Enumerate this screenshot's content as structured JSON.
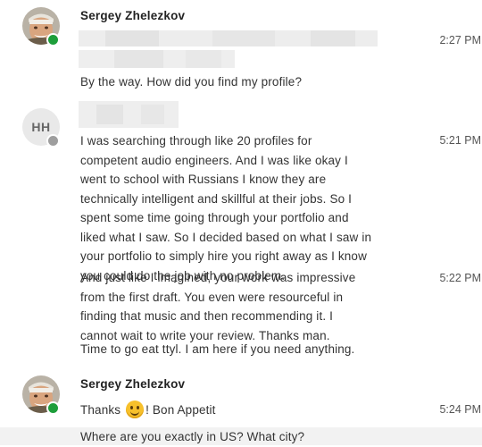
{
  "thread": {
    "messages": [
      {
        "sender": "Sergey Zhelezkov",
        "time": "2:27 PM",
        "text": "By the way. How did you find my profile?"
      },
      {
        "initials": "HH",
        "time": "5:21 PM",
        "text_lines": [
          "I was searching through like 20 profiles for",
          "competent audio engineers. And I was like okay I",
          "went to school with Russians I know they are",
          "technically intelligent and skillful at their jobs. So I",
          "spent some time going through your portfolio and",
          "liked what I saw. So I decided based on what I saw in",
          "your portfolio to simply hire you right away as I know",
          "you could do the job with no problem."
        ]
      },
      {
        "time": "5:22 PM",
        "text_lines": [
          "And just like I imagined, your work was impressive",
          "from the first draft. You even were resourceful in",
          "finding that music and then recommending it. I",
          "cannot wait to write your review. Thanks man."
        ]
      },
      {
        "text": "Time to go eat ttyl. I am here if you need anything."
      },
      {
        "sender": "Sergey Zhelezkov",
        "time": "5:24 PM",
        "text_before": "Thanks",
        "emoji": "smiling-face-emoji",
        "text_after": "! Bon Appetit"
      },
      {
        "text": "Where are you exactly in US? What city?"
      }
    ]
  },
  "icons": {
    "online_status": "online-status-dot",
    "away_status": "away-status-dot"
  },
  "colors": {
    "online": "#1d9e3a",
    "away": "#9e9e9e",
    "emoji": "#f7c02b"
  }
}
